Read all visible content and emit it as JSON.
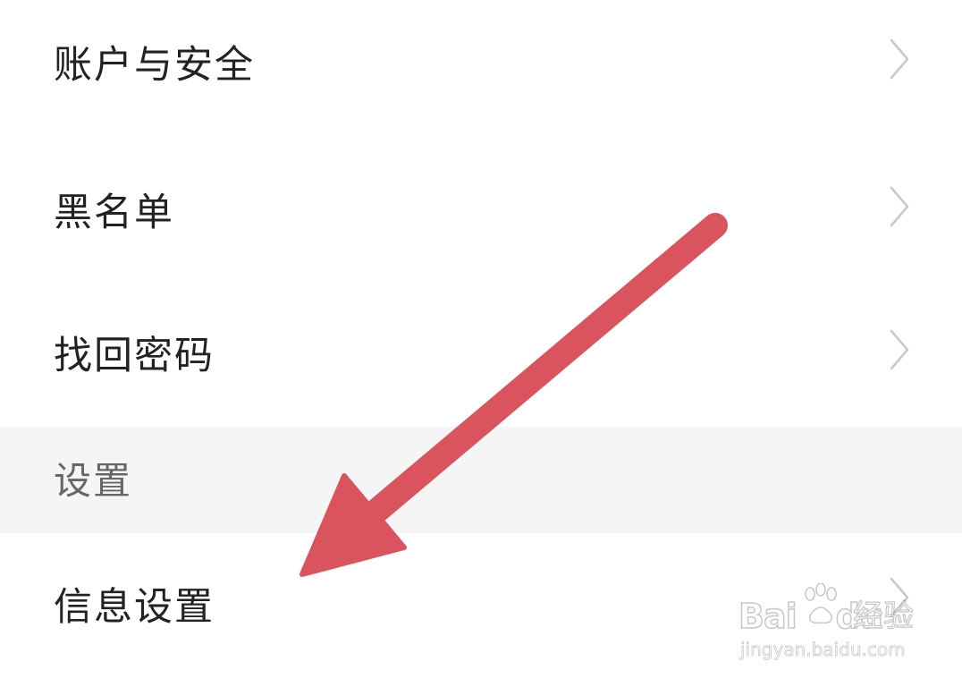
{
  "settings_list": {
    "items": [
      {
        "label": "账户与安全",
        "icon": "chevron-right-icon"
      },
      {
        "label": "黑名单",
        "icon": "chevron-right-icon"
      },
      {
        "label": "找回密码",
        "icon": "chevron-right-icon"
      }
    ],
    "section_header": "设置",
    "section_items": [
      {
        "label": "信息设置",
        "icon": "chevron-right-icon"
      }
    ]
  },
  "annotation": {
    "arrow_color": "#d9545c"
  },
  "watermark": {
    "brand": "Bai",
    "brand_suffix": "du",
    "product": "经验",
    "url": "jingyan.baidu.com"
  },
  "colors": {
    "background": "#ffffff",
    "section_background": "#f5f5f5",
    "text": "#222222",
    "section_text": "#666666",
    "chevron": "#c8c8c8"
  }
}
